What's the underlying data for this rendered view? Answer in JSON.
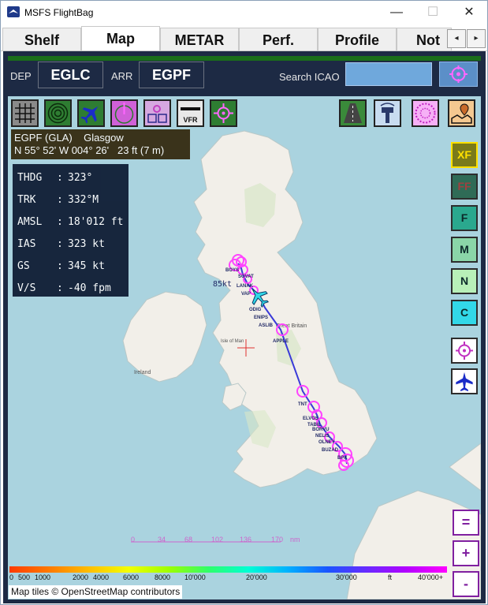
{
  "window": {
    "title": "MSFS FlightBag",
    "minimize_glyph": "—",
    "maximize_glyph": "☐",
    "close_glyph": "✕"
  },
  "tabs": [
    {
      "label": "Shelf",
      "active": false
    },
    {
      "label": "Map",
      "active": true
    },
    {
      "label": "METAR",
      "active": false
    },
    {
      "label": "Perf.",
      "active": false
    },
    {
      "label": "Profile",
      "active": false
    },
    {
      "label": "Not",
      "active": false
    }
  ],
  "tab_scroll": {
    "left": "◂",
    "right": "▸"
  },
  "route": {
    "dep_label": "DEP",
    "dep": "EGLC",
    "arr_label": "ARR",
    "arr": "EGPF",
    "search_label": "Search ICAO",
    "search_value": ""
  },
  "map_tools": [
    {
      "icon": "grid-icon"
    },
    {
      "icon": "radar-rings-icon"
    },
    {
      "icon": "aircraft-icon"
    },
    {
      "icon": "compass-heading-icon"
    },
    {
      "icon": "vor-ndb-icon"
    },
    {
      "icon": "vfr-icon",
      "text": "VFR"
    },
    {
      "icon": "target-icon"
    }
  ],
  "map_layers": [
    {
      "icon": "runway-icon"
    },
    {
      "icon": "control-tower-icon"
    },
    {
      "icon": "navaid-rose-icon"
    },
    {
      "icon": "map-pin-icon"
    }
  ],
  "airport_info": {
    "line1": "EGPF (GLA)    Glasgow",
    "line2": "N 55° 52' W 004° 26'   23 ft (7 m)"
  },
  "flight_data": [
    {
      "key": "THDG",
      "sep": ":",
      "value": "323°"
    },
    {
      "key": "TRK",
      "sep": ":",
      "value": "332°M"
    },
    {
      "key": "AMSL",
      "sep": ":",
      "value": "18'012 ft"
    },
    {
      "key": "IAS",
      "sep": ":",
      "value": "323 kt"
    },
    {
      "key": "GS",
      "sep": ":",
      "value": "345 kt"
    },
    {
      "key": "V/S",
      "sep": ":",
      "value": "-40 fpm"
    }
  ],
  "map_styles": [
    {
      "label": "XF",
      "color": "#7a7a1a",
      "text_color": "#ffe000",
      "active": true
    },
    {
      "label": "FF",
      "color": "#2f6b56",
      "text_color": "#a04040",
      "active": false
    },
    {
      "label": "F",
      "color": "#2aa88e",
      "text_color": "#0b2a2a",
      "active": false
    },
    {
      "label": "M",
      "color": "#8ad6a8",
      "text_color": "#0b2a2a",
      "active": false
    },
    {
      "label": "N",
      "color": "#b8f0b8",
      "text_color": "#0b2a2a",
      "active": false
    },
    {
      "label": "C",
      "color": "#32d8e8",
      "text_color": "#0b2a2a",
      "active": false
    }
  ],
  "side_actions": [
    {
      "icon": "center-target-icon"
    },
    {
      "icon": "follow-aircraft-icon"
    }
  ],
  "zoom": {
    "reset": "=",
    "in": "+",
    "out": "-"
  },
  "waypoints": [
    "BOYS",
    "SOVAT",
    "LANAK",
    "VAP",
    "ODIG",
    "ENIPS",
    "ASLIB",
    "APPLE",
    "TNT",
    "ELVOS",
    "TABIL",
    "BORVU",
    "NELIS",
    "OLNEY",
    "BUZAD",
    "BPK"
  ],
  "wind_label": "85kt",
  "scale_bar": {
    "ticks": [
      "0",
      "34",
      "68",
      "102",
      "136",
      "170"
    ],
    "unit": "nm"
  },
  "altitude_bar": {
    "ticks": [
      "0",
      "500",
      "1000",
      "2000",
      "4000",
      "6000",
      "8000",
      "10'000",
      "20'000",
      "30'000",
      "40'000+"
    ],
    "unit": "ft"
  },
  "attribution": "Map tiles © OpenStreetMap contributors",
  "map_place_labels": [
    "Great Britain",
    "Isle of Man",
    "Ireland"
  ],
  "colors": {
    "route": "#3a3ad8",
    "waypoint": "#ff44ff",
    "aircraft": "#30d8e8",
    "panel": "#1d2a44",
    "sea": "#aad3df",
    "land": "#f2efe9"
  }
}
